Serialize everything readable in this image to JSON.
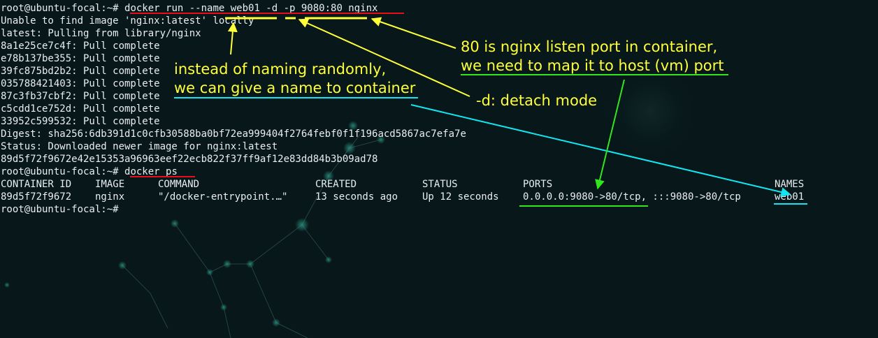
{
  "terminal": {
    "prompt": "root@ubuntu-focal:~# ",
    "run_command": "docker run --name web01 -d -p 9080:80 nginx",
    "output_lines": [
      "Unable to find image 'nginx:latest' locally",
      "latest: Pulling from library/nginx",
      "8a1e25ce7c4f: Pull complete",
      "e78b137be355: Pull complete",
      "39fc875bd2b2: Pull complete",
      "035788421403: Pull complete",
      "87c3fb37cbf2: Pull complete",
      "c5cdd1ce752d: Pull complete",
      "33952c599532: Pull complete",
      "Digest: sha256:6db391d1c0cfb30588ba0bf72ea999404f2764febf0f1f196acd5867ac7efa7e",
      "Status: Downloaded newer image for nginx:latest",
      "89d5f72f9672e42e15353a96963eef22ecb822f37ff9af12e83dd84b3b09ad78"
    ],
    "ps_command": "docker ps",
    "ps_headers": [
      "CONTAINER ID",
      "IMAGE",
      "COMMAND",
      "CREATED",
      "STATUS",
      "PORTS",
      "NAMES"
    ],
    "ps_row": [
      "89d5f72f9672",
      "nginx",
      "\"/docker-entrypoint.…\"",
      "13 seconds ago",
      "Up 12 seconds",
      "0.0.0.0:9080->80/tcp, :::9080->80/tcp",
      "web01"
    ],
    "final_prompt": "root@ubuntu-focal:~# "
  },
  "annotations": {
    "name_line1": "instead of naming randomly,",
    "name_line2": "we can give a name to container",
    "detach": "-d: detach mode",
    "port_line1": "80 is nginx listen port in container,",
    "port_line2": "we need to map it to host (vm) port"
  },
  "colors": {
    "background": "#07171a",
    "terminal_text": "#e9eef0",
    "annotation_text": "#ffff3a",
    "underline_red": "#e8101a",
    "underline_yellow": "#ffff3a",
    "underline_cyan": "#12e6f0",
    "underline_green": "#32e61e"
  }
}
